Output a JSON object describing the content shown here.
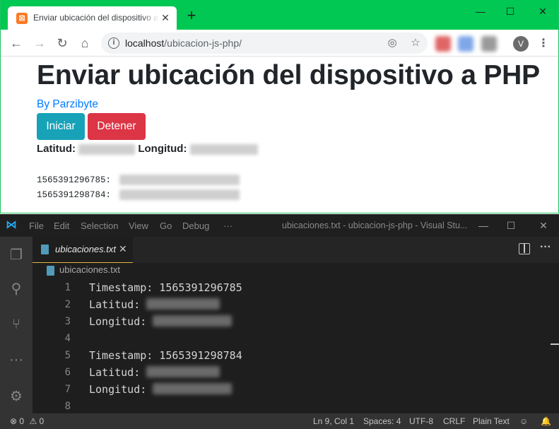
{
  "browser": {
    "tab_title": "Enviar ubicación del dispositivo a PHP",
    "url_host": "localhost",
    "url_path": "/ubicacion-js-php/",
    "favicon_icon": "xampp-icon"
  },
  "page": {
    "heading": "Enviar ubicación del dispositivo a PHP",
    "author": "By Parzibyte",
    "start_button": "Iniciar",
    "stop_button": "Detener",
    "lat_label": "Latitud:",
    "lon_label": "Longitud:",
    "log": [
      {
        "timestamp": "1565391296785:"
      },
      {
        "timestamp": "1565391298784:"
      }
    ]
  },
  "vscode": {
    "menu": [
      "File",
      "Edit",
      "Selection",
      "View",
      "Go",
      "Debug",
      "···"
    ],
    "window_title": "ubicaciones.txt - ubicacion-js-php - Visual Stu...",
    "tab_label": "ubicaciones.txt",
    "breadcrumb": "ubicaciones.txt",
    "lines": [
      {
        "n": "1",
        "text": "Timestamp: 1565391296785"
      },
      {
        "n": "2",
        "text": "Latitud:"
      },
      {
        "n": "3",
        "text": "Longitud:"
      },
      {
        "n": "4",
        "text": ""
      },
      {
        "n": "5",
        "text": "Timestamp: 1565391298784"
      },
      {
        "n": "6",
        "text": "Latitud:"
      },
      {
        "n": "7",
        "text": "Longitud:"
      },
      {
        "n": "8",
        "text": ""
      }
    ],
    "status": {
      "errors": "0",
      "warnings": "0",
      "position": "Ln 9, Col 1",
      "spaces": "Spaces: 4",
      "encoding": "UTF-8",
      "eol": "CRLF",
      "language": "Plain Text"
    }
  }
}
